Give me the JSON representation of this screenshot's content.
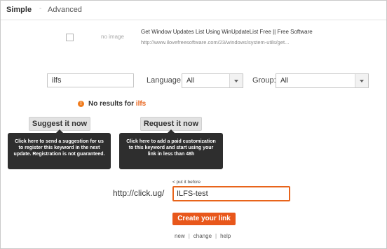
{
  "header": {
    "tab_simple": "Simple",
    "separator": "-",
    "tab_advanced": "Advanced"
  },
  "result": {
    "image_placeholder": "no image",
    "title": "Get Window Updates List Using WinUpdateList Free || Free Software",
    "url": "http://www.ilovefreesoftware.com/23/windows/system-utils/get..."
  },
  "search": {
    "keyword_value": "ilfs",
    "language_label": "Language:",
    "language_value": "All",
    "group_label": "Group:",
    "group_value": "All"
  },
  "status": {
    "warning_glyph": "!",
    "no_results_text": "No results for",
    "no_results_keyword": "ilfs",
    "accent_color": "#e8641b"
  },
  "suggest": {
    "button_label": "Suggest it now",
    "tooltip": "Click here to send a suggestion for us to register this keyword in the next update. Registration is not guaranteed."
  },
  "request": {
    "button_label": "Request it now",
    "tooltip": "Click here to add a paid customization to this keyword and start using your link in less than 48h"
  },
  "link": {
    "put_before_label": "< put it before",
    "prefix": "http://click.ug/",
    "value": "ILFS-test",
    "create_button": "Create your link"
  },
  "footer": {
    "links": [
      "new",
      "change",
      "help"
    ],
    "separator": "|"
  }
}
